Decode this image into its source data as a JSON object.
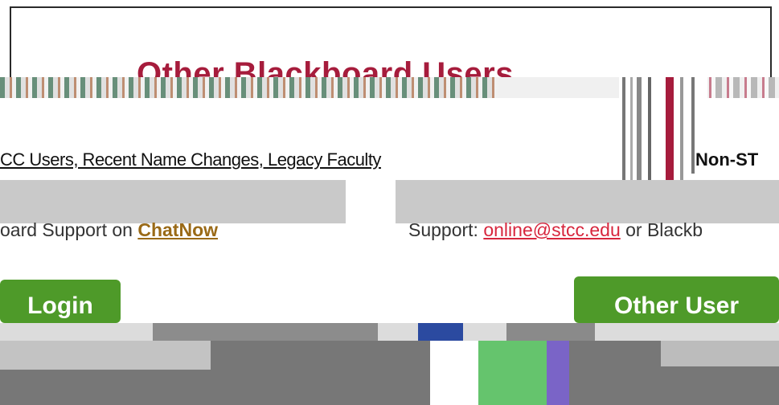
{
  "heading": "Other Blackboard Users",
  "user_types": {
    "stcc": "CC Users, Recent Name Changes, Legacy Faculty",
    "non_stcc": "Non-ST"
  },
  "support": {
    "left_prefix": "oard Support on ",
    "left_link": "ChatNow",
    "right_prefix": "Support: ",
    "right_email": "online@stcc.edu",
    "right_suffix": " or Blackb"
  },
  "buttons": {
    "login": "Login",
    "other_user": "Other User"
  },
  "colors": {
    "heading": "#a61c3c",
    "button": "#4e9a29",
    "chat_link": "#9a6a17",
    "email_link": "#d7263d",
    "glitch_green": "#65c46d",
    "glitch_purple": "#7a64c7",
    "glitch_blue": "#2b4aa0"
  }
}
